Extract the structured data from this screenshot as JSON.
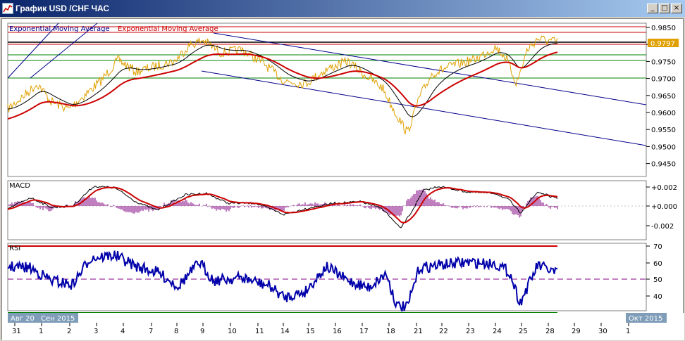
{
  "window": {
    "title": "График USD /CHF ЧАС",
    "buttons": {
      "minimize": "_",
      "restore": "□",
      "close": "×"
    }
  },
  "main_panel": {
    "legend_left": "Exponential Moving Average",
    "legend_right": "Exponential Moving Average",
    "price_ticks": [
      "0.9850",
      "0.9800",
      "0.9750",
      "0.9700",
      "0.9650",
      "0.9600",
      "0.9550",
      "0.9500",
      "0.9450"
    ],
    "current_price": "0.9797"
  },
  "macd_panel": {
    "label": "MACD",
    "ticks": [
      "+0.002",
      "+0.000",
      "-0.002"
    ]
  },
  "rsi_panel": {
    "label": "RSI",
    "ticks": [
      "70",
      "60",
      "50",
      "40"
    ]
  },
  "time_axis": {
    "ticks": [
      "31",
      "1",
      "2",
      "3",
      "4",
      "7",
      "8",
      "9",
      "10",
      "11",
      "14",
      "15",
      "16",
      "17",
      "18",
      "21",
      "22",
      "23",
      "24",
      "25",
      "28",
      "29",
      "30",
      "1"
    ],
    "month_labels": [
      "Авг 20",
      "Сен 2015",
      "Окт 2015"
    ]
  },
  "colors": {
    "price": "#e0a000",
    "ema_fast": "#000000",
    "ema_slow": "#cc0000",
    "channel": "#00008b",
    "support": "#008000",
    "resistance": "#cc0000",
    "rsi": "#0000aa",
    "macd_hist": "#800080"
  }
}
